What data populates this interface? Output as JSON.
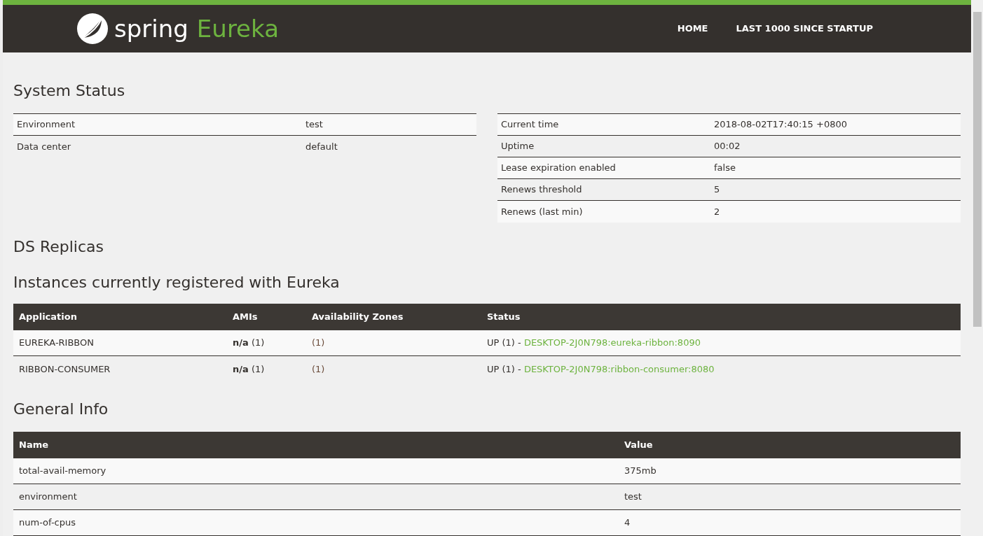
{
  "header": {
    "logo_word": "spring",
    "logo_product": "Eureka",
    "nav": [
      {
        "label": "HOME"
      },
      {
        "label": "LAST 1000 SINCE STARTUP"
      }
    ]
  },
  "system_status": {
    "title": "System Status",
    "left": [
      {
        "label": "Environment",
        "value": "test"
      },
      {
        "label": "Data center",
        "value": "default"
      }
    ],
    "right": [
      {
        "label": "Current time",
        "value": "2018-08-02T17:40:15 +0800"
      },
      {
        "label": "Uptime",
        "value": "00:02"
      },
      {
        "label": "Lease expiration enabled",
        "value": "false"
      },
      {
        "label": "Renews threshold",
        "value": "5"
      },
      {
        "label": "Renews (last min)",
        "value": "2"
      }
    ]
  },
  "ds_replicas": {
    "title": "DS Replicas"
  },
  "instances": {
    "title": "Instances currently registered with Eureka",
    "columns": [
      "Application",
      "AMIs",
      "Availability Zones",
      "Status"
    ],
    "rows": [
      {
        "application": "EUREKA-RIBBON",
        "amis": "**n/a** (1)",
        "zones": "(1)",
        "status": "UP (1) -",
        "link": "DESKTOP-2J0N798:eureka-ribbon:8090"
      },
      {
        "application": "RIBBON-CONSUMER",
        "amis": "**n/a** (1)",
        "zones": "(1)",
        "status": "UP (1) -",
        "link": "DESKTOP-2J0N798:ribbon-consumer:8080"
      }
    ]
  },
  "general_info": {
    "title": "General Info",
    "columns": [
      "Name",
      "Value"
    ],
    "rows": [
      {
        "name": "total-avail-memory",
        "value": "375mb"
      },
      {
        "name": "environment",
        "value": "test"
      },
      {
        "name": "num-of-cpus",
        "value": "4"
      }
    ]
  }
}
